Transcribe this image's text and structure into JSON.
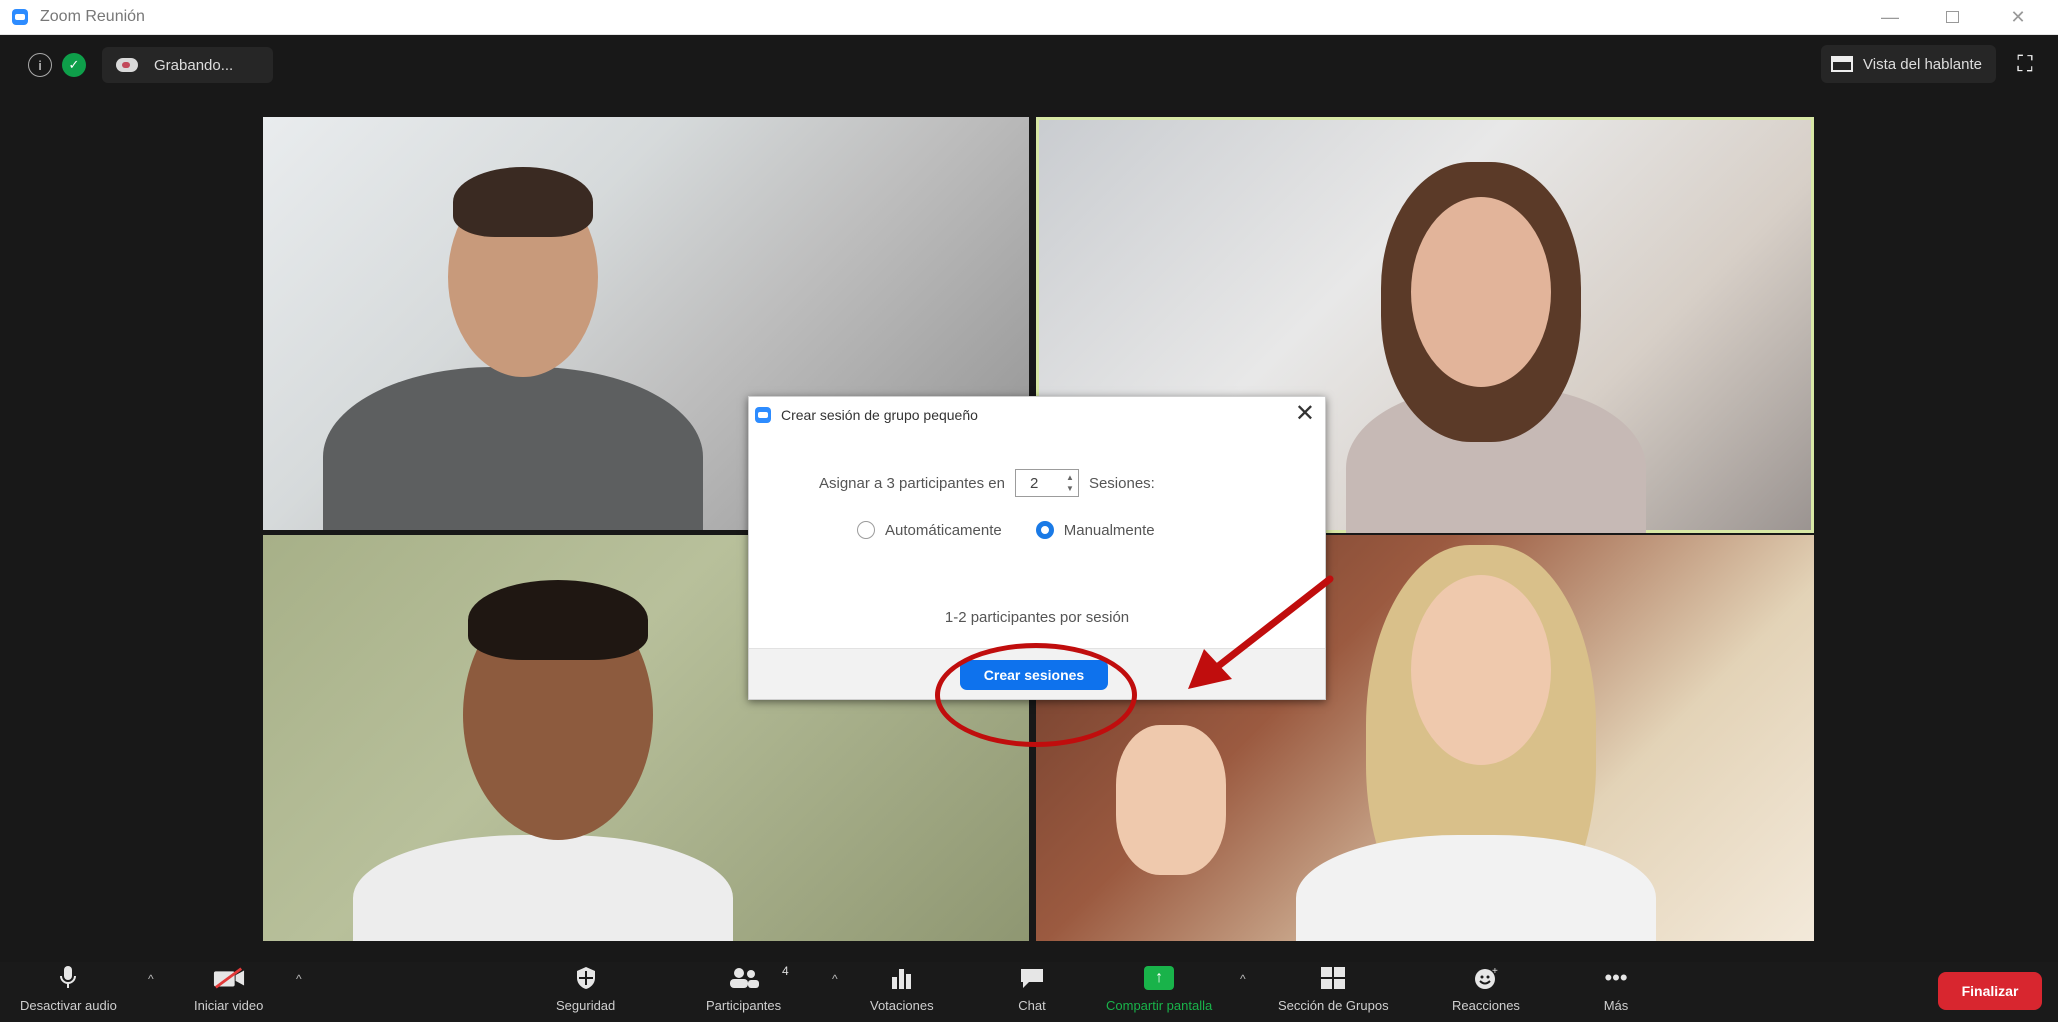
{
  "window": {
    "title": "Zoom Reunión"
  },
  "top_bar": {
    "recording_label": "Grabando...",
    "speaker_view_label": "Vista del hablante"
  },
  "participants": [
    {
      "tile": "top-left"
    },
    {
      "tile": "top-right",
      "active_speaker": true
    },
    {
      "tile": "bottom-left"
    },
    {
      "tile": "bottom-right"
    }
  ],
  "dialog": {
    "title": "Crear sesión de grupo pequeño",
    "assign_prefix": "Asignar a 3 participantes en",
    "sessions_value": "2",
    "sessions_suffix": "Sesiones:",
    "option_auto": "Automáticamente",
    "option_manual": "Manualmente",
    "selected_option": "manual",
    "hint": "1-2 participantes por sesión",
    "create_button": "Crear sesiones"
  },
  "toolbar": {
    "mute_label": "Desactivar audio",
    "video_label": "Iniciar video",
    "security_label": "Seguridad",
    "participants_label": "Participantes",
    "participants_count": "4",
    "polls_label": "Votaciones",
    "chat_label": "Chat",
    "share_label": "Compartir pantalla",
    "breakout_label": "Sección de Grupos",
    "reactions_label": "Reacciones",
    "more_label": "Más",
    "end_label": "Finalizar"
  },
  "colors": {
    "accent_blue": "#0e72ed",
    "share_green": "#19b34a",
    "end_red": "#d8262f",
    "annotation_red": "#c00d0d",
    "active_speaker_border": "#d7e7a5"
  },
  "icons": {
    "info": "info-icon",
    "security": "shield-icon",
    "recording": "cloud-record-icon",
    "speaker_view": "grid-icon",
    "fullscreen": "fullscreen-icon"
  }
}
